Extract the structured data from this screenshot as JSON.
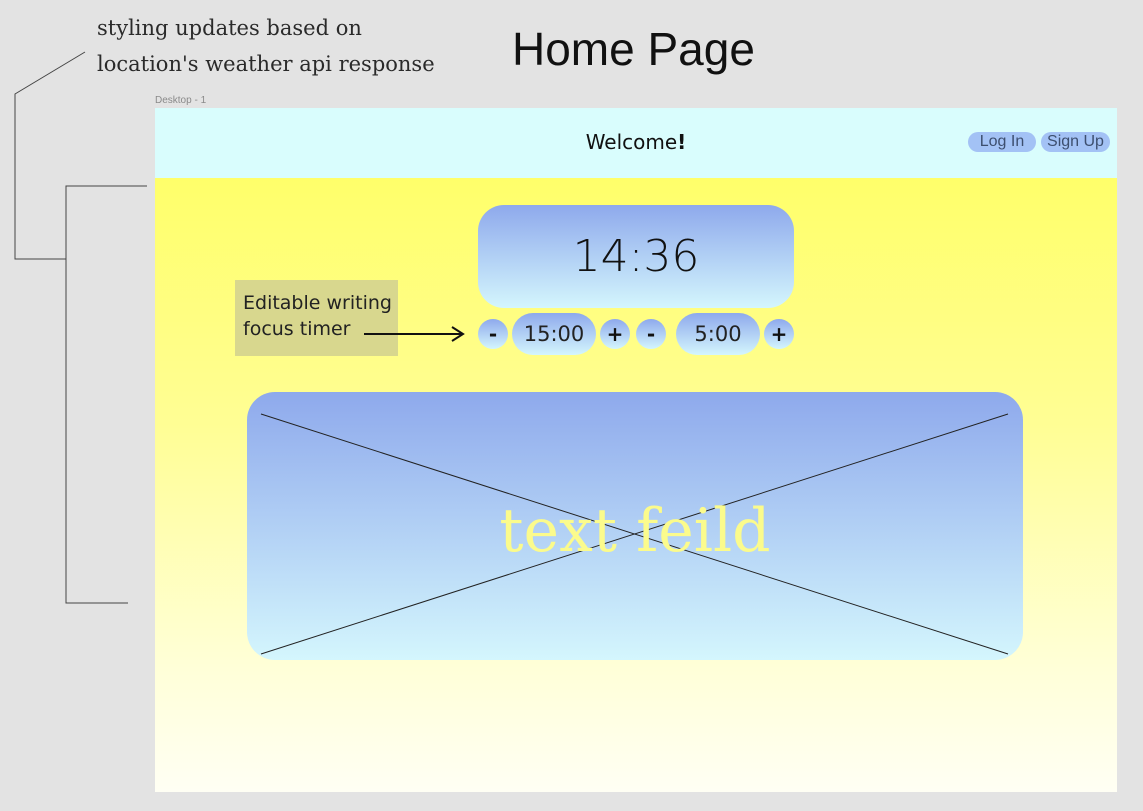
{
  "annotations": {
    "styling_note_line1": "styling updates based on",
    "styling_note_line2": "location's weather api response",
    "page_heading": "Home Page",
    "frame_label": "Desktop - 1",
    "sticky_note_line1": "Editable writing",
    "sticky_note_line2": "focus timer"
  },
  "header": {
    "welcome_text": "Welcome",
    "welcome_emphasis": "!",
    "login_label": "Log In",
    "signup_label": "Sign Up"
  },
  "timer": {
    "current_time": "14:36",
    "focus": {
      "decrement": "-",
      "value": "15:00",
      "increment": "+"
    },
    "break": {
      "decrement": "-",
      "value": "5:00",
      "increment": "+"
    }
  },
  "text_field": {
    "placeholder_label": "text feild"
  },
  "colors": {
    "header_bg": "#d9fdfd",
    "gradient_top": "#ffff6a",
    "gradient_bottom": "#fffff4",
    "widget_gradient_top": "#8ea9ec",
    "widget_gradient_bottom": "#d4f6fd",
    "nav_button": "#a3c2f5",
    "textfield_label": "#fbfb8c",
    "sticky_note": "#d8d78e"
  },
  "icons": {
    "callout": "annotation-bracket-lines",
    "arrow": "right-arrow"
  }
}
